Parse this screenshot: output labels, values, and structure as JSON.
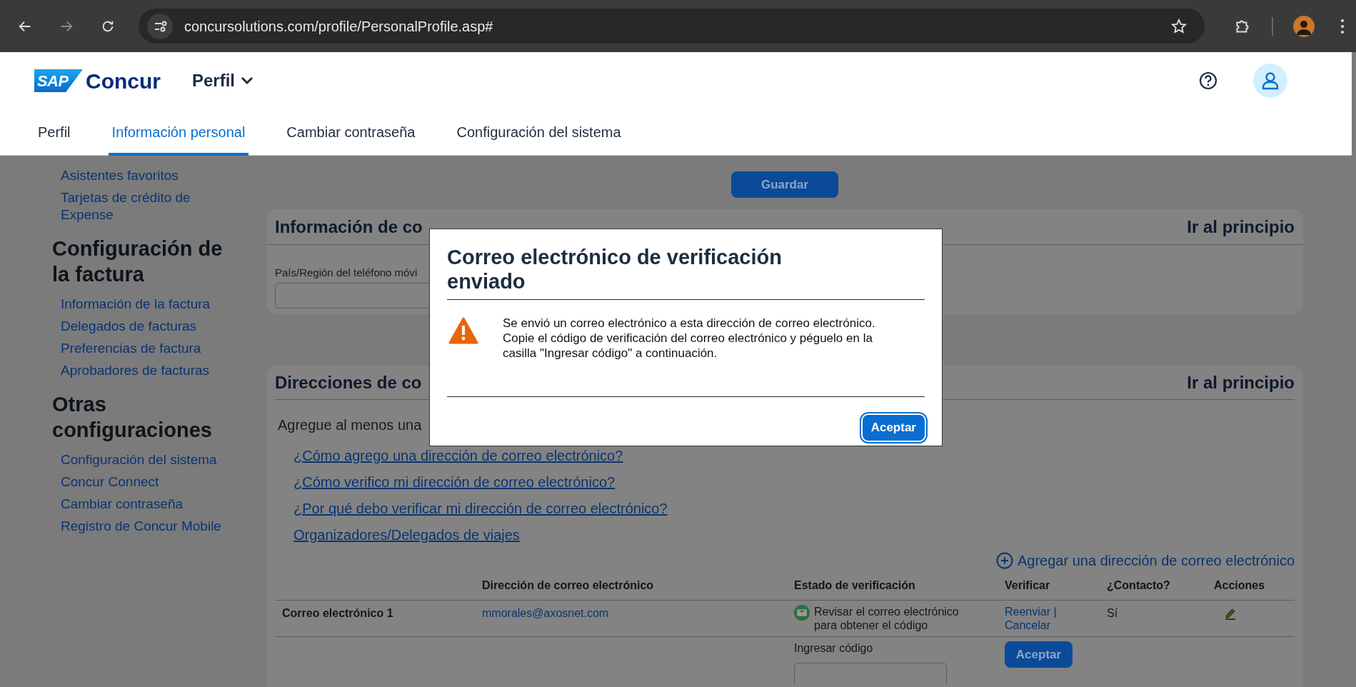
{
  "browser": {
    "url": "concursolutions.com/profile/PersonalProfile.asp#"
  },
  "header": {
    "brand_mark": "SAP",
    "brand": "Concur",
    "menu": "Perfil",
    "tabs": [
      {
        "label": "Perfil",
        "selected": false
      },
      {
        "label": "Información personal",
        "selected": true
      },
      {
        "label": "Cambiar contraseña",
        "selected": false
      },
      {
        "label": "Configuración del sistema",
        "selected": false
      }
    ]
  },
  "sidebar": {
    "items": [
      {
        "kind": "link",
        "label": "Asistentes favoritos"
      },
      {
        "kind": "link",
        "label": "Tarjetas de crédito de Expense"
      },
      {
        "kind": "heading",
        "label": "Configuración de la factura"
      },
      {
        "kind": "link",
        "label": "Información de la factura"
      },
      {
        "kind": "link",
        "label": "Delegados de facturas"
      },
      {
        "kind": "link",
        "label": "Preferencias de factura"
      },
      {
        "kind": "link",
        "label": "Aprobadores de facturas"
      },
      {
        "kind": "heading",
        "label": "Otras configuraciones"
      },
      {
        "kind": "link",
        "label": "Configuración del sistema"
      },
      {
        "kind": "link",
        "label": "Concur Connect"
      },
      {
        "kind": "link",
        "label": "Cambiar contraseña"
      },
      {
        "kind": "link",
        "label": "Registro de Concur Mobile"
      }
    ]
  },
  "save_button": "Guardar",
  "contact_section": {
    "title": "Información de co",
    "top_link": "Ir al principio",
    "field_label": "País/Región del teléfono móvi"
  },
  "email_section": {
    "title": "Direcciones de co",
    "top_link": "Ir al principio",
    "intro": "Agregue al menos una",
    "help_links": [
      "¿Cómo agrego una dirección de correo electrónico?",
      "¿Cómo verifico mi dirección de correo electrónico?",
      "¿Por qué debo verificar mi dirección de correo electrónico?",
      "Organizadores/Delegados de viajes"
    ],
    "add_link": "Agregar una dirección de correo electrónico",
    "table": {
      "columns": [
        "Dirección de correo electrónico",
        "Estado de verificación",
        "Verificar",
        "¿Contacto?",
        "Acciones"
      ],
      "rows": [
        {
          "label": "Correo electrónico 1",
          "email": "mmorales@axosnet.com",
          "status": "Revisar el correo electrónico para obtener el código",
          "resend": "Reenviar |",
          "cancel": "Cancelar",
          "contact": "Sí"
        }
      ],
      "code_row": {
        "label": "Ingresar código",
        "button": "Aceptar"
      }
    }
  },
  "dialog": {
    "title": "Correo electrónico de verificación enviado",
    "message": "Se envió un correo electrónico a esta dirección de correo electrónico. Copie el código de verificación del correo electrónico y péguelo en la casilla \"Ingresar código\" a continuación.",
    "button": "Aceptar"
  }
}
